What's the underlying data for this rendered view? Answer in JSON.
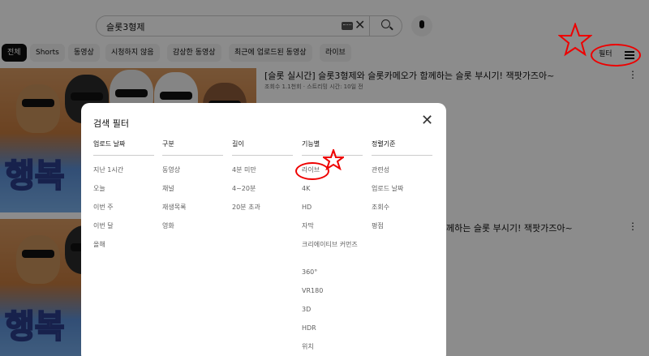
{
  "search": {
    "query": "슬롯3형제"
  },
  "chips": [
    "전체",
    "Shorts",
    "동영상",
    "시청하지 않음",
    "감상한 동영상",
    "최근에 업로드된 동영상",
    "라이브"
  ],
  "filter_button": {
    "label": "필터"
  },
  "videos": [
    {
      "title": "[슬롯 실시간] 슬롯3형제와 슬롯카메오가 함께하는 슬롯 부시기! 잭팟가즈아~",
      "meta": "조회수 1.1천회 · 스트리밍 시간: 10일 전",
      "thumb_text": "행복"
    },
    {
      "title": "께하는 슬롯 부시기! 잭팟가즈아~",
      "thumb_text": "행복"
    }
  ],
  "dialog": {
    "title": "검색 필터",
    "columns": [
      {
        "header": "업로드 날짜",
        "items": [
          "지난 1시간",
          "오늘",
          "이번 주",
          "이번 달",
          "올해"
        ]
      },
      {
        "header": "구분",
        "items": [
          "동영상",
          "채널",
          "재생목록",
          "영화"
        ]
      },
      {
        "header": "길이",
        "items": [
          "4분 미만",
          "4~20분",
          "20분 초과"
        ]
      },
      {
        "header": "기능별",
        "items": [
          "라이브",
          "4K",
          "HD",
          "자막",
          "크리에이티브 커먼즈",
          "360°",
          "VR180",
          "3D",
          "HDR",
          "위치"
        ]
      },
      {
        "header": "정렬기준",
        "items": [
          "관련성",
          "업로드 날짜",
          "조회수",
          "평점"
        ]
      }
    ]
  },
  "colors": {
    "annotation": "#e00000",
    "chip_active": "#0f0f0f",
    "chip": "#f2f2f2"
  }
}
